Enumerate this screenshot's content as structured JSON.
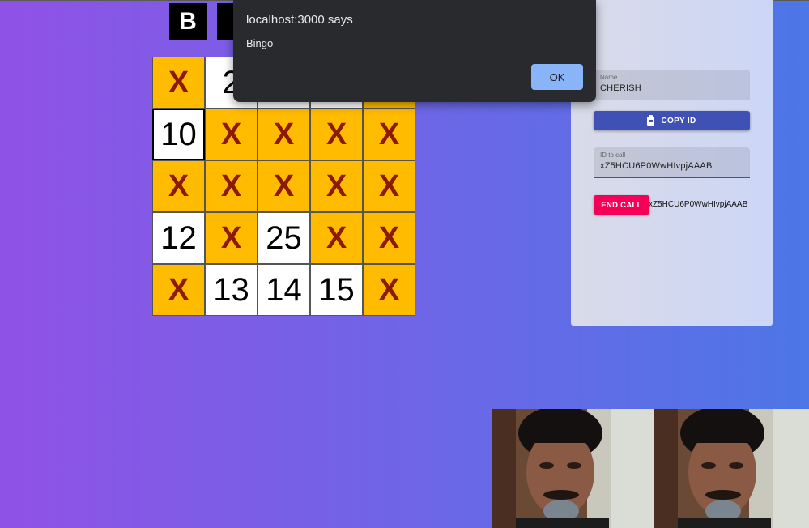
{
  "header": {
    "letters": [
      "B",
      ""
    ]
  },
  "board": {
    "cells": [
      "X",
      "2",
      "",
      "",
      "",
      "10",
      "X",
      "X",
      "X",
      "X",
      "X",
      "X",
      "X",
      "X",
      "X",
      "12",
      "X",
      "25",
      "X",
      "X",
      "X",
      "13",
      "14",
      "15",
      "X"
    ],
    "marked_color": "#ffbb00",
    "mark_text_color": "#8b1a00"
  },
  "panel": {
    "name_label": "Name",
    "name_value": "CHERISH",
    "copy_button": "COPY ID",
    "id_label": "ID to call",
    "id_value": "xZ5HCU6P0WwHIvpjAAAB",
    "end_call_button": "END CALL",
    "call_id": "xZ5HCU6P0WwHIvpjAAAB"
  },
  "dialog": {
    "title": "localhost:3000 says",
    "message": "Bingo",
    "ok_label": "OK"
  },
  "colors": {
    "copy_button": "#3f51b5",
    "end_call_button": "#f50057",
    "dialog_ok": "#8ab4f8"
  }
}
